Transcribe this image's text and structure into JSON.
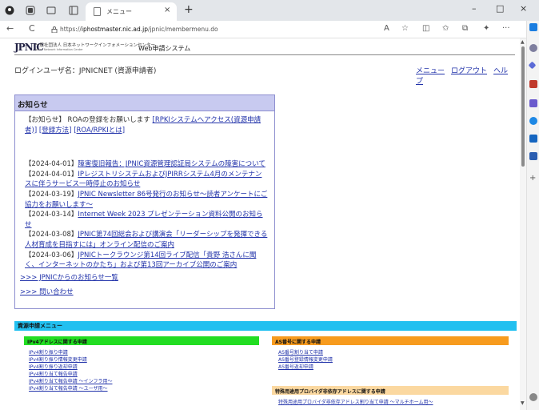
{
  "browser": {
    "tab_title": "メニュー",
    "url_prefix": "https://",
    "url_host": "iphostmaster.nic.ad.jp",
    "url_path": "/jpnic/membermenu.do",
    "tab_close": "×",
    "new_tab": "+",
    "win_min": "–",
    "win_max": "□",
    "win_close": "×",
    "nav_back": "←",
    "nav_reload": "C",
    "tool_read": "A",
    "tool_fav": "☆",
    "tool_split": "◫",
    "tool_favbar": "✩",
    "tool_collections": "⧉",
    "tool_ext": "✦",
    "tool_more": "···"
  },
  "header": {
    "logo": "JPNIC",
    "org_name": "一般社団法人 日本ネットワークインフォメーションセンター",
    "org_en": "Japan Network Information Center",
    "system_name": "Web申請システム"
  },
  "login_user": "ログインユーザ名：JPNICNET (資源申請者)",
  "top_links": [
    "メニュー",
    "ログアウト",
    "ヘルプ"
  ],
  "news": {
    "title": "お知らせ",
    "notice_prefix": "【お知らせ】 ROAの登録をお願いします ",
    "notice_links": [
      "[RPKIシステムへアクセス(資源申請者)]",
      "[登録方法]",
      "[ROA/RPKIとは]"
    ],
    "items": [
      {
        "date": "【2024-04-01】",
        "text": "障害復旧報告：JPNIC資源管理認証局システムの障害について"
      },
      {
        "date": "【2024-04-01】",
        "text": "IPレジストリシステムおよびJPIRRシステム4月のメンテナンスに伴うサービス一時停止のお知らせ"
      },
      {
        "date": "【2024-03-19】",
        "text": "JPNIC Newsletter 86号発行のお知らせ～読者アンケートにご協力をお願いします～"
      },
      {
        "date": "【2024-03-14】",
        "text": "Internet Week 2023 プレゼンテーション資料公開のお知らせ"
      },
      {
        "date": "【2024-03-08】",
        "text": "JPNIC第74回総会および講演会「リーダーシップを発揮できる人材育成を目指すには」オンライン配信のご案内"
      },
      {
        "date": "【2024-03-06】",
        "text": "JPNICトークラウンジ第14回ライブ配信「貴野 浩さんに聞く、インターネットのかたち」および第13回アーカイブ公開のご案内"
      }
    ],
    "more_links": [
      ">>> JPNICからのお知らせ一覧",
      ">>> 問い合わせ"
    ]
  },
  "app_menu": {
    "title": "資源申請メニュー",
    "ipv4_title": "IPv4アドレスに関する申請",
    "ipv4_links": [
      "IPv4割り振り申請",
      "IPv4割り振り情報変更申請",
      "IPv4割り振り返却申請",
      "IPv4割り当て報告申請",
      "IPv4割り当て報告申請 ～インフラ用～",
      "IPv4割り当て報告申請 ～ユーザ用～"
    ],
    "as_title": "AS番号に関する申請",
    "as_links": [
      "AS番号割り当て申請",
      "AS番号登録情報変更申請",
      "AS番号返却申請"
    ],
    "special_title": "特殊用途用プロバイダ非依存アドレスに関する申請",
    "special_links": [
      "特殊用途用プロバイダ非依存アドレス割り当て申請 ～マルチホーム用～"
    ]
  }
}
